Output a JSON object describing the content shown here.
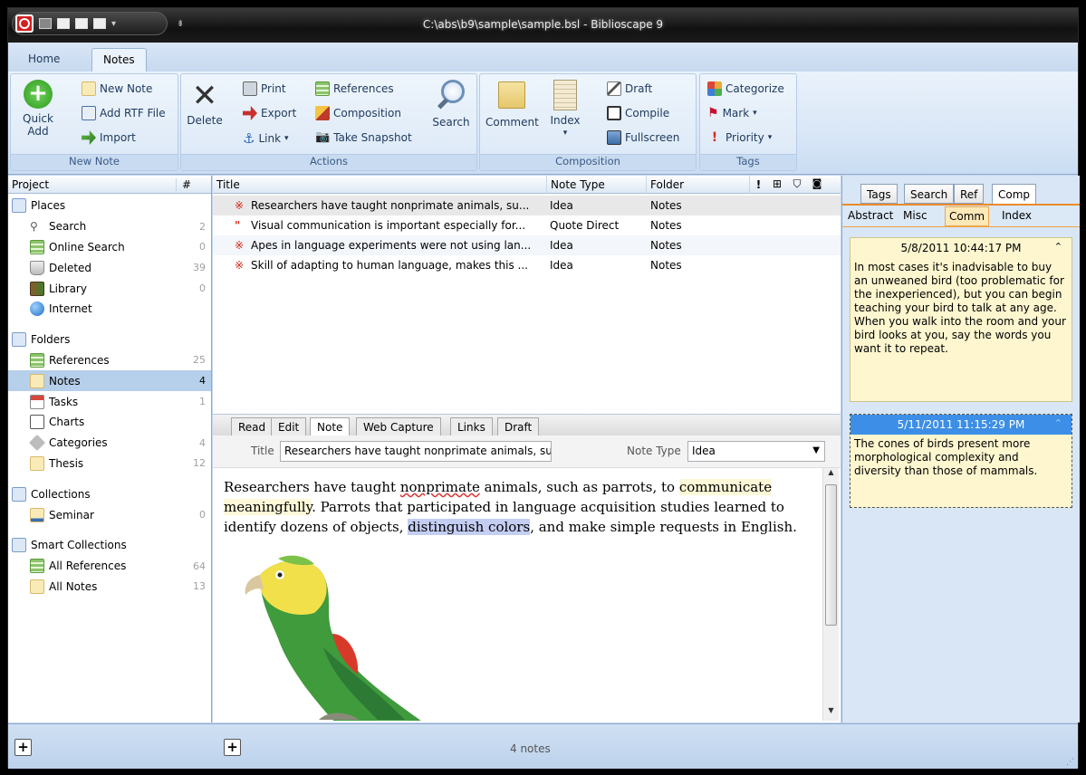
{
  "window": {
    "title": "C:\\abs\\b9\\sample\\sample.bsl - Biblioscape 9"
  },
  "ribbon": {
    "tabs": [
      {
        "label": "Home"
      },
      {
        "label": "Notes"
      }
    ],
    "groups": {
      "new_note": {
        "label": "New Note",
        "quick_add": "Quick\nAdd",
        "quick_add_l1": "Quick",
        "quick_add_l2": "Add",
        "new_note": "New Note",
        "add_rtf": "Add RTF File",
        "import": "Import"
      },
      "actions": {
        "label": "Actions",
        "delete": "Delete",
        "print": "Print",
        "export": "Export",
        "link": "Link",
        "references": "References",
        "composition": "Composition",
        "take_snapshot": "Take Snapshot",
        "search": "Search"
      },
      "composition": {
        "label": "Composition",
        "comment": "Comment",
        "index": "Index",
        "draft": "Draft",
        "compile": "Compile",
        "fullscreen": "Fullscreen"
      },
      "tags": {
        "label": "Tags",
        "categorize": "Categorize",
        "mark": "Mark",
        "priority": "Priority"
      }
    }
  },
  "left_panel": {
    "header_project": "Project",
    "header_count": "#",
    "sections": {
      "places": "Places",
      "folders": "Folders",
      "collections": "Collections",
      "smart_collections": "Smart Collections"
    },
    "places": [
      {
        "label": "Search",
        "count": "2"
      },
      {
        "label": "Online Search",
        "count": "0"
      },
      {
        "label": "Deleted",
        "count": "39"
      },
      {
        "label": "Library",
        "count": "0"
      },
      {
        "label": "Internet",
        "count": ""
      }
    ],
    "folders": [
      {
        "label": "References",
        "count": "25"
      },
      {
        "label": "Notes",
        "count": "4"
      },
      {
        "label": "Tasks",
        "count": "1"
      },
      {
        "label": "Charts",
        "count": ""
      },
      {
        "label": "Categories",
        "count": "4"
      },
      {
        "label": "Thesis",
        "count": "12"
      }
    ],
    "collections": [
      {
        "label": "Seminar",
        "count": "0"
      }
    ],
    "smart_collections": [
      {
        "label": "All References",
        "count": "64"
      },
      {
        "label": "All Notes",
        "count": "13"
      }
    ]
  },
  "note_list": {
    "columns": {
      "title": "Title",
      "note_type": "Note Type",
      "folder": "Folder"
    },
    "rows": [
      {
        "title": "Researchers have taught nonprimate animals, su...",
        "type": "Idea",
        "folder": "Notes"
      },
      {
        "title": "Visual communication is important especially for...",
        "type": "Quote Direct",
        "folder": "Notes"
      },
      {
        "title": "Apes in language experiments were not using lan...",
        "type": "Idea",
        "folder": "Notes"
      },
      {
        "title": "Skill of adapting to human language, makes this ...",
        "type": "Idea",
        "folder": "Notes"
      }
    ]
  },
  "editor": {
    "tabs": [
      {
        "label": "Read"
      },
      {
        "label": "Edit"
      },
      {
        "label": "Note"
      },
      {
        "label": "Web Capture"
      },
      {
        "label": "Links"
      },
      {
        "label": "Draft"
      }
    ],
    "title_label": "Title",
    "title_value": "Researchers have taught nonprimate animals, such as p",
    "note_type_label": "Note Type",
    "note_type_value": "Idea",
    "body": {
      "p1": "Researchers have taught ",
      "p2": "nonprimate",
      "p3": " animals, such as parrots, to ",
      "p4": "communicate meaningfully",
      "p5": ". Parrots that participated in language acquisition studies learned to identify dozens of objects, ",
      "p6": "distinguish colors",
      "p7": ", and make simple requests in English."
    }
  },
  "right_panel": {
    "top_tabs": [
      {
        "label": "Tags"
      },
      {
        "label": "Search"
      },
      {
        "label": "Ref"
      },
      {
        "label": "Comp"
      }
    ],
    "sub_tabs": [
      {
        "label": "Abstract"
      },
      {
        "label": "Misc"
      },
      {
        "label": "Comm"
      },
      {
        "label": "Index"
      }
    ],
    "comments": [
      {
        "date": "5/8/2011 10:44:17 PM",
        "text": "In most cases it's inadvisable to buy an unweaned bird (too problematic for the inexperienced), but you can begin teaching your bird to talk at any age. When you walk into the room and your bird looks at you, say the words you want it to repeat."
      },
      {
        "date": "5/11/2011 11:15:29 PM",
        "text": "The cones of birds present more morphological complexity and diversity than those of mammals."
      }
    ]
  },
  "status": {
    "count_text": "4 notes"
  }
}
